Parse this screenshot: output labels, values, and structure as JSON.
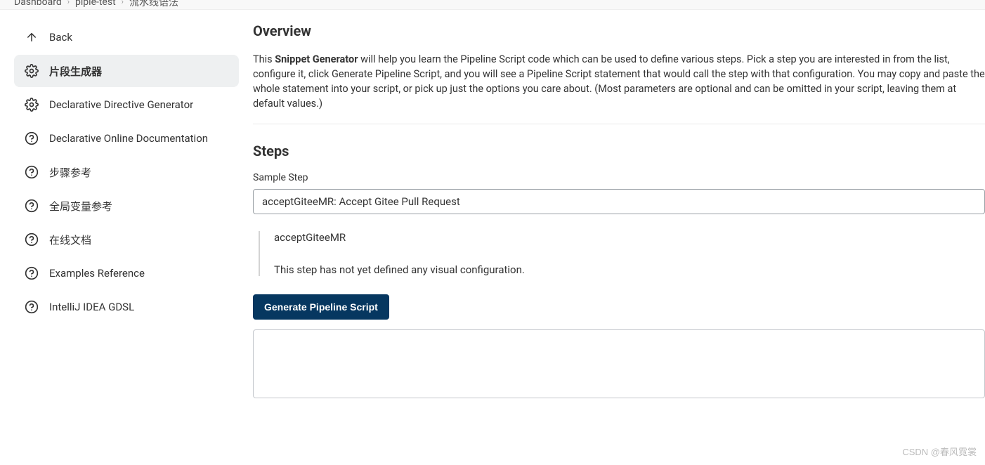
{
  "breadcrumb": {
    "items": [
      "Dashboard",
      "piple-test",
      "流水线语法"
    ]
  },
  "sidebar": {
    "items": [
      {
        "label": "Back",
        "icon": "arrow-up"
      },
      {
        "label": "片段生成器",
        "icon": "gear",
        "selected": true
      },
      {
        "label": "Declarative Directive Generator",
        "icon": "gear"
      },
      {
        "label": "Declarative Online Documentation",
        "icon": "help"
      },
      {
        "label": "步骤参考",
        "icon": "help"
      },
      {
        "label": "全局变量参考",
        "icon": "help"
      },
      {
        "label": "在线文档",
        "icon": "help"
      },
      {
        "label": "Examples Reference",
        "icon": "help"
      },
      {
        "label": "IntelliJ IDEA GDSL",
        "icon": "help"
      }
    ]
  },
  "main": {
    "overview_heading": "Overview",
    "overview_prefix": "This ",
    "overview_bold": "Snippet Generator",
    "overview_rest": " will help you learn the Pipeline Script code which can be used to define various steps. Pick a step you are interested in from the list, configure it, click Generate Pipeline Script, and you will see a Pipeline Script statement that would call the step with that configuration. You may copy and paste the whole statement into your script, or pick up just the options you care about. (Most parameters are optional and can be omitted in your script, leaving them at default values.)",
    "steps_heading": "Steps",
    "sample_step_label": "Sample Step",
    "sample_step_value": "acceptGiteeMR: Accept Gitee Pull Request",
    "step_name": "acceptGiteeMR",
    "step_note": "This step has not yet defined any visual configuration.",
    "generate_button": "Generate Pipeline Script",
    "output_value": ""
  },
  "watermark": "CSDN @春风霓裳"
}
